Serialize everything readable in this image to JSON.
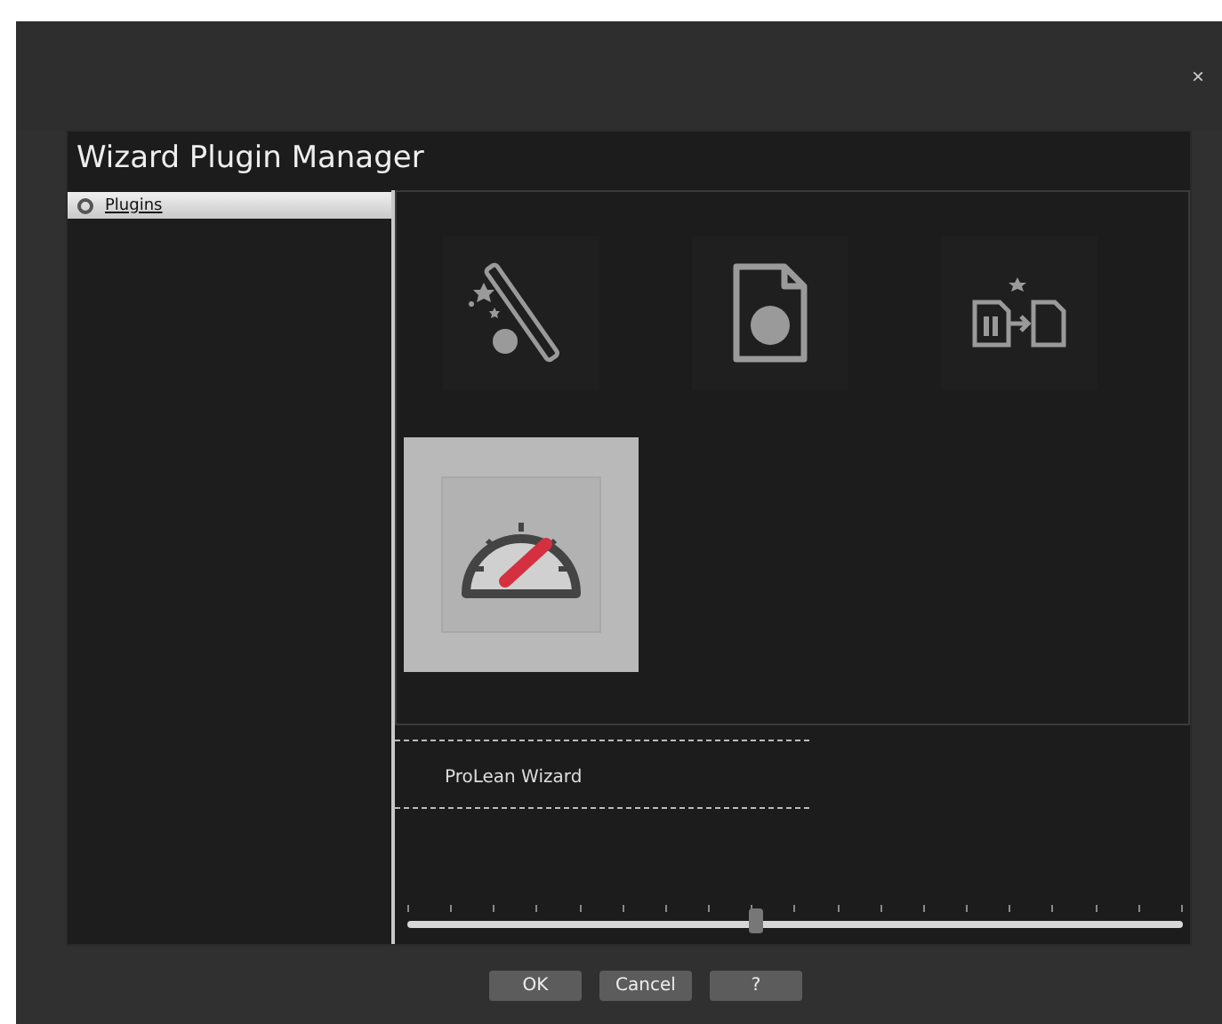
{
  "window": {
    "close": "×"
  },
  "title": "Wizard Plugin Manager",
  "sidebar": {
    "items": [
      {
        "label": "Plugins",
        "selected": true
      }
    ]
  },
  "plugins": [
    {
      "kind": "wand",
      "selected": false
    },
    {
      "kind": "new-document",
      "selected": false
    },
    {
      "kind": "convert",
      "selected": false
    },
    {
      "kind": "gauge",
      "selected": true
    }
  ],
  "details": {
    "name": "ProLean Wizard"
  },
  "slider": {
    "level": 0.45
  },
  "buttons": [
    "OK",
    "Cancel",
    "?"
  ]
}
